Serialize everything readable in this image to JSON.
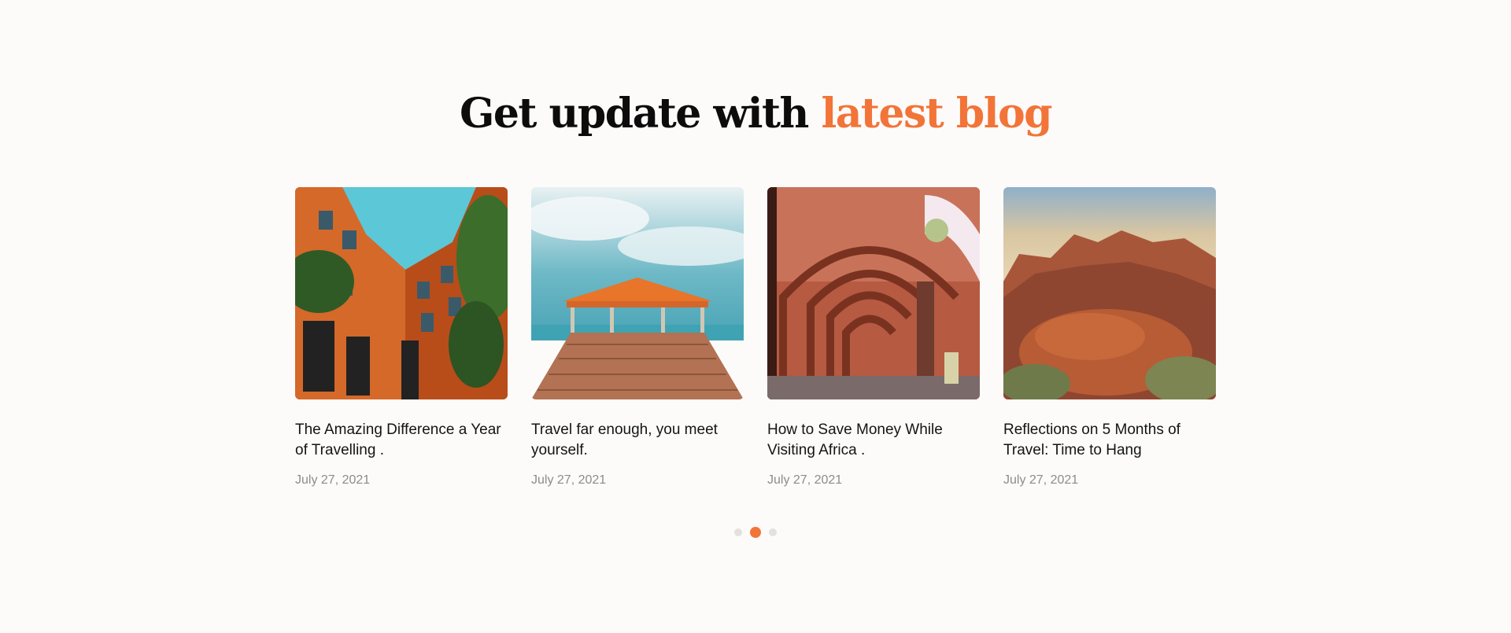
{
  "section": {
    "title_main": "Get update with",
    "title_accent": "latest blog"
  },
  "posts": [
    {
      "title": "The Amazing Difference a Year of Travelling .",
      "date": "July 27, 2021",
      "image": "orange-building-courtyard"
    },
    {
      "title": "Travel far enough, you meet yourself.",
      "date": "July 27, 2021",
      "image": "pier-gazebo-sea"
    },
    {
      "title": "How to Save Money While Visiting Africa .",
      "date": "July 27, 2021",
      "image": "arched-colonnade"
    },
    {
      "title": "Reflections on 5 Months of Travel: Time to Hang",
      "date": "July 27, 2021",
      "image": "red-rock-canyon"
    }
  ],
  "carousel": {
    "pages": 3,
    "active_page": 2
  },
  "colors": {
    "accent": "#f27438",
    "background": "#fcfbf9",
    "date_text": "#8c8c8c"
  }
}
